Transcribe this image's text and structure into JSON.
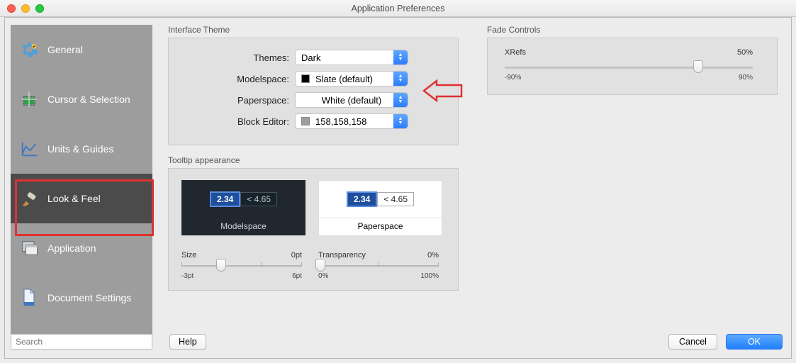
{
  "window": {
    "title": "Application Preferences"
  },
  "sidebar": {
    "items": [
      {
        "label": "General"
      },
      {
        "label": "Cursor & Selection"
      },
      {
        "label": "Units & Guides"
      },
      {
        "label": "Look & Feel"
      },
      {
        "label": "Application"
      },
      {
        "label": "Document Settings"
      }
    ],
    "selected_index": 3
  },
  "sections": {
    "interface_theme": {
      "title": "Interface Theme",
      "rows": {
        "themes": {
          "label": "Themes:",
          "value": "Dark",
          "swatch": null
        },
        "modelspace": {
          "label": "Modelspace:",
          "value": "Slate (default)",
          "swatch": "#000000"
        },
        "paperspace": {
          "label": "Paperspace:",
          "value": "White (default)",
          "swatch": "#ffffff"
        },
        "block_editor": {
          "label": "Block Editor:",
          "value": "158,158,158",
          "swatch": "#9e9e9e"
        }
      }
    },
    "tooltip": {
      "title": "Tooltip appearance",
      "preview": {
        "a_value": "2.34",
        "b_value": "< 4.65",
        "modelspace_label": "Modelspace",
        "paperspace_label": "Paperspace"
      },
      "size": {
        "label": "Size",
        "value": "0pt",
        "min": "-3pt",
        "max": "6pt",
        "knob_pos_pct": 33
      },
      "transparency": {
        "label": "Transparency",
        "value": "0%",
        "min": "0%",
        "max": "100%",
        "knob_pos_pct": 0
      }
    },
    "fade": {
      "title": "Fade Controls",
      "xrefs": {
        "label": "XRefs",
        "value": "50%",
        "min": "-90%",
        "max": "90%",
        "knob_pos_pct": 78
      }
    }
  },
  "footer": {
    "search_placeholder": "Search",
    "help": "Help",
    "cancel": "Cancel",
    "ok": "OK"
  },
  "icons": {
    "general": "gear-icon",
    "cursor": "cursor-crop-icon",
    "units": "ruler-axis-icon",
    "look": "paintbrush-icon",
    "application": "window-stack-icon",
    "document": "document-icon"
  }
}
